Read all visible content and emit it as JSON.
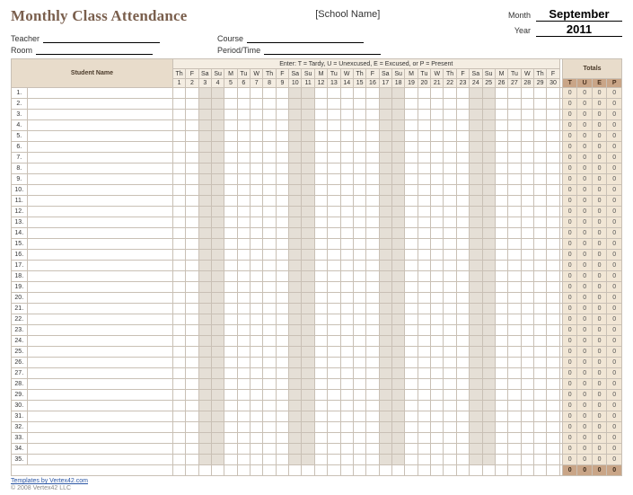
{
  "title": "Monthly Class Attendance",
  "school_placeholder": "[School Name]",
  "fields": {
    "teacher_label": "Teacher",
    "room_label": "Room",
    "course_label": "Course",
    "period_label": "Period/Time",
    "month_label": "Month",
    "year_label": "Year",
    "month_value": "September",
    "year_value": "2011"
  },
  "headers": {
    "student_name": "Student Name",
    "legend": "Enter:  T = Tardy,   U = Unexcused,   E = Excused,  or P = Present",
    "totals": "Totals"
  },
  "days": {
    "dow": [
      "Th",
      "F",
      "Sa",
      "Su",
      "M",
      "Tu",
      "W",
      "Th",
      "F",
      "Sa",
      "Su",
      "M",
      "Tu",
      "W",
      "Th",
      "F",
      "Sa",
      "Su",
      "M",
      "Tu",
      "W",
      "Th",
      "F",
      "Sa",
      "Su",
      "M",
      "Tu",
      "W",
      "Th",
      "F"
    ],
    "num": [
      1,
      2,
      3,
      4,
      5,
      6,
      7,
      8,
      9,
      10,
      11,
      12,
      13,
      14,
      15,
      16,
      17,
      18,
      19,
      20,
      21,
      22,
      23,
      24,
      25,
      26,
      27,
      28,
      29,
      30
    ],
    "weekend_idx": [
      2,
      3,
      9,
      10,
      16,
      17,
      23,
      24
    ]
  },
  "total_cols": [
    "T",
    "U",
    "E",
    "P"
  ],
  "rows": 35,
  "row_totals_default": [
    "0",
    "0",
    "0",
    "0"
  ],
  "footer_totals": [
    "0",
    "0",
    "0",
    "0"
  ],
  "credits": "Templates by Vertex42.com",
  "copyright": "© 2008 Vertex42 LLC"
}
